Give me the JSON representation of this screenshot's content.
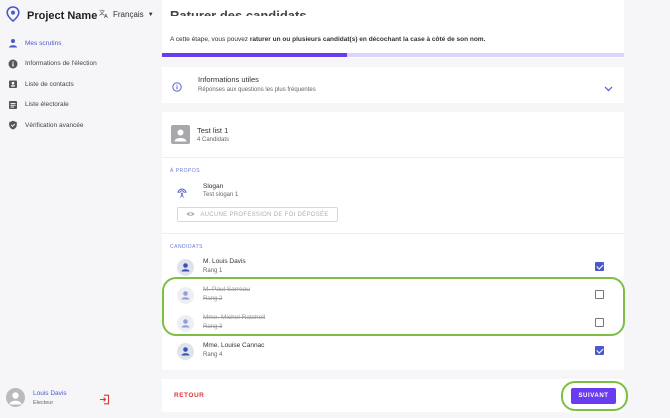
{
  "app": {
    "name": "Project Name"
  },
  "language": {
    "selected": "Français"
  },
  "sidebar": {
    "items": [
      {
        "label": "Mes scrutins",
        "icon": "person-key-icon",
        "active": true
      },
      {
        "label": "Informations de l'élection",
        "icon": "info-icon",
        "active": false
      },
      {
        "label": "Liste de contacts",
        "icon": "contacts-icon",
        "active": false
      },
      {
        "label": "Liste électorale",
        "icon": "list-icon",
        "active": false
      },
      {
        "label": "Vérification avancée",
        "icon": "shield-check-icon",
        "active": false
      }
    ]
  },
  "user": {
    "name": "Louis Davis",
    "role": "Electeur"
  },
  "step": {
    "title_fragment": "Raturer des candidats",
    "instruction_prefix": "A cette étape, vous pouvez ",
    "instruction_bold": "raturer un ou plusieurs candidat(s) en décochant la case à côté de son nom.",
    "progress": 0.4
  },
  "info_panel": {
    "title": "Informations utiles",
    "subtitle": "Réponses aux questions les plus fréquentes"
  },
  "list": {
    "title": "Test list 1",
    "count": "4 Candidats",
    "about_label": "À PROPOS",
    "slogan_title": "Slogan",
    "slogan_value": "Test slogan 1",
    "profession_button": "AUCUNE PROFESSION DE FOI DÉPOSÉE",
    "candidates_label": "CANDIDATS",
    "candidates": [
      {
        "name": "M. Louis Davis",
        "rank": "Rang 1",
        "checked": true
      },
      {
        "name": "M. Paul Sarreau",
        "rank": "Rang 2",
        "checked": false
      },
      {
        "name": "Mme. Michel Ratchell",
        "rank": "Rang 3",
        "checked": false
      },
      {
        "name": "Mme. Louise Cannac",
        "rank": "Rang 4",
        "checked": true
      }
    ]
  },
  "footer": {
    "back_label": "RETOUR",
    "next_label": "SUIVANT"
  },
  "colors": {
    "accent": "#6a3cf0",
    "nav_active": "#4a58c9",
    "highlight": "#7dbf42",
    "back": "#d93a3a"
  }
}
